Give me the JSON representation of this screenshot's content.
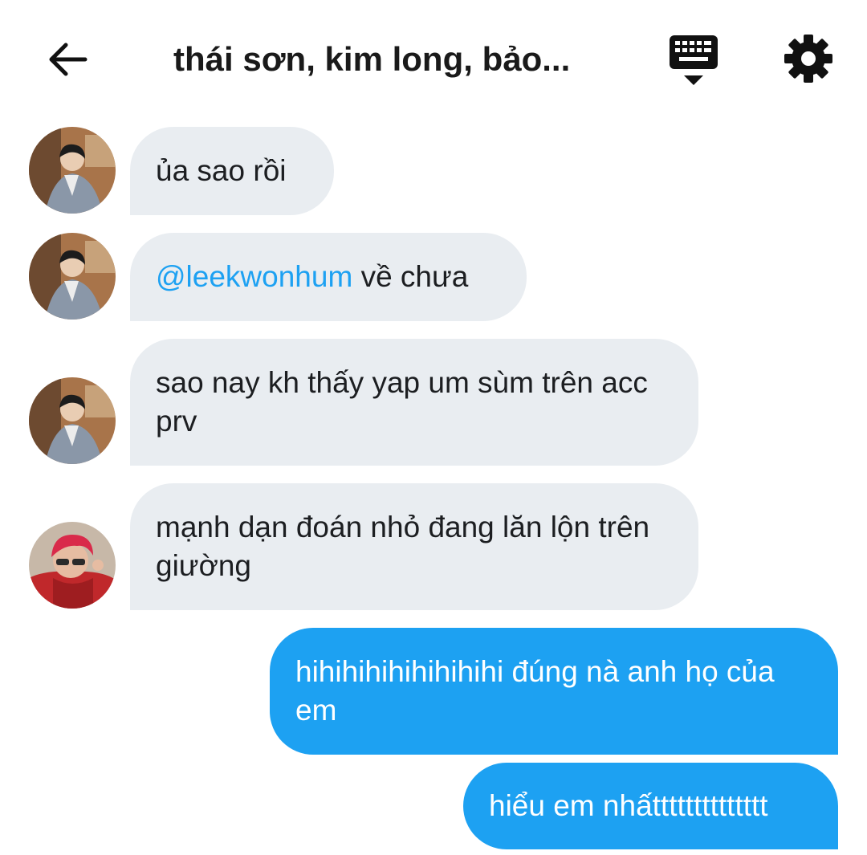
{
  "header": {
    "title": "thái sơn, kim long, bảo...",
    "back_icon": "arrow-left-icon",
    "keyboard_icon": "keyboard-icon",
    "settings_icon": "gear-icon"
  },
  "colors": {
    "incoming_bubble": "#e9edf1",
    "outgoing_bubble": "#1da1f2",
    "mention": "#1da1f2",
    "text": "#1c1e21"
  },
  "messages": [
    {
      "direction": "incoming",
      "sender_avatar": "avatar-gray-cardigan",
      "text": "ủa sao rồi"
    },
    {
      "direction": "incoming",
      "sender_avatar": "avatar-gray-cardigan",
      "mention": "@leekwonhum",
      "text": " về chưa"
    },
    {
      "direction": "incoming",
      "sender_avatar": "avatar-gray-cardigan",
      "text": "sao nay kh thấy yap um sùm trên acc prv"
    },
    {
      "direction": "incoming",
      "sender_avatar": "avatar-red-hair",
      "text": "mạnh dạn đoán nhỏ đang lăn lộn trên giường"
    },
    {
      "direction": "outgoing",
      "text": "hihihihihihihihihi đúng nà anh họ của em"
    },
    {
      "direction": "outgoing",
      "text": "hiểu em nhấtttttttttttttt"
    }
  ]
}
